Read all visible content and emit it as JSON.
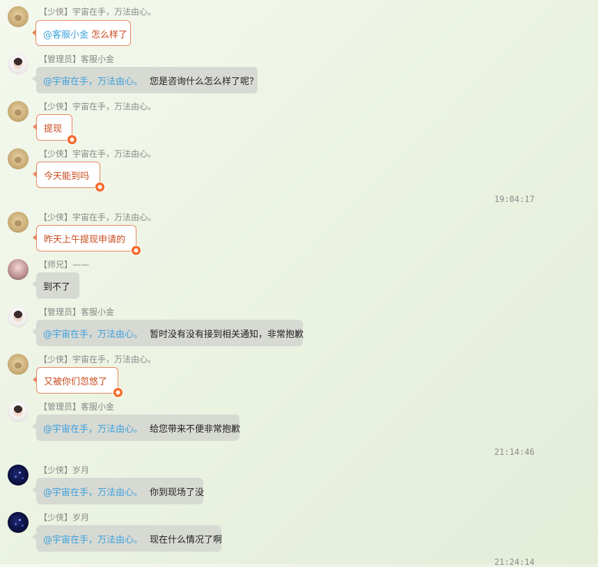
{
  "messages": [
    {
      "avatar": "bear-avatar",
      "role": "【少侠】",
      "name": "宇宙在手，万法由心。",
      "style": "red",
      "mention": "@客服小金",
      "text": "怎么样了"
    },
    {
      "avatar": "admin-avatar",
      "role": "【管理员】",
      "name": "客服小金",
      "style": "gray",
      "mention": "@宇宙在手，万法由心。",
      "text": "您是咨询什么怎么样了呢？"
    },
    {
      "avatar": "bear-avatar",
      "role": "【少侠】",
      "name": "宇宙在手，万法由心。",
      "style": "red",
      "mention": "",
      "text": "提现"
    },
    {
      "avatar": "bear-avatar",
      "role": "【少侠】",
      "name": "宇宙在手，万法由心。",
      "style": "red",
      "mention": "",
      "text": "今天能到吗"
    },
    {
      "timestamp": "19:04:17"
    },
    {
      "avatar": "bear-avatar",
      "role": "【少侠】",
      "name": "宇宙在手，万法由心。",
      "style": "red",
      "mention": "",
      "text": "昨天上午提现申请的"
    },
    {
      "avatar": "girl-avatar",
      "role": "【师兄】",
      "name": "——",
      "style": "gray",
      "mention": "",
      "text": "到不了"
    },
    {
      "avatar": "admin-avatar",
      "role": "【管理员】",
      "name": "客服小金",
      "style": "gray",
      "mention": "@宇宙在手，万法由心。",
      "text": "暂时没有没有接到相关通知，非常抱歉"
    },
    {
      "avatar": "bear-avatar",
      "role": "【少侠】",
      "name": "宇宙在手，万法由心。",
      "style": "red",
      "mention": "",
      "text": "又被你们忽悠了"
    },
    {
      "avatar": "admin-avatar",
      "role": "【管理员】",
      "name": "客服小金",
      "style": "gray",
      "mention": "@宇宙在手，万法由心。",
      "text": "给您带来不便非常抱歉"
    },
    {
      "timestamp": "21:14:46"
    },
    {
      "avatar": "night-avatar",
      "role": "【少侠】",
      "name": "岁月",
      "style": "gray",
      "mention": "@宇宙在手，万法由心。",
      "text": "你到现场了没"
    },
    {
      "avatar": "night-avatar",
      "role": "【少侠】",
      "name": "岁月",
      "style": "gray",
      "mention": "@宇宙在手，万法由心。",
      "text": "现在什么情况了啊"
    },
    {
      "timestamp": "21:24:14"
    }
  ]
}
